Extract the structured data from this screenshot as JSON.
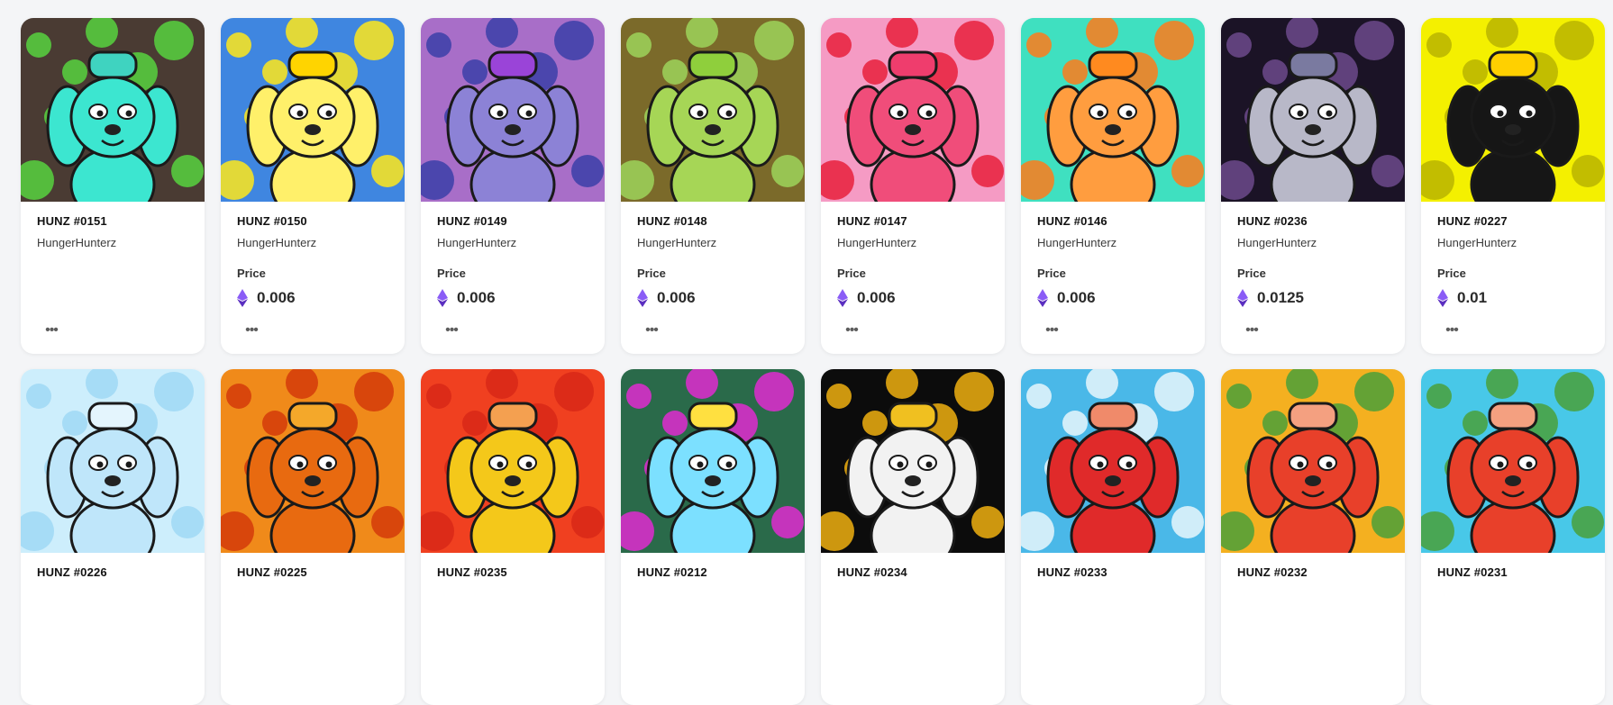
{
  "cards": [
    {
      "title": "HUNZ #0151",
      "collection": "HungerHunterz",
      "price_label": "",
      "price": "",
      "bg": "#4a3b33",
      "accent": "#57d33f",
      "body": "#3ce6d0",
      "hat": "#3fd3c0"
    },
    {
      "title": "HUNZ #0150",
      "collection": "HungerHunterz",
      "price_label": "Price",
      "price": "0.006",
      "bg": "#3f86e0",
      "accent": "#ffe81a",
      "body": "#fff06a",
      "hat": "#ffd400"
    },
    {
      "title": "HUNZ #0149",
      "collection": "HungerHunterz",
      "price_label": "Price",
      "price": "0.006",
      "bg": "#a86ec8",
      "accent": "#3b3fa8",
      "body": "#8c82d6",
      "hat": "#9a44d8"
    },
    {
      "title": "HUNZ #0148",
      "collection": "HungerHunterz",
      "price_label": "Price",
      "price": "0.006",
      "bg": "#7b6a2a",
      "accent": "#9ed35a",
      "body": "#a6d656",
      "hat": "#8fcf3c"
    },
    {
      "title": "HUNZ #0147",
      "collection": "HungerHunterz",
      "price_label": "Price",
      "price": "0.006",
      "bg": "#f59bc4",
      "accent": "#e8203c",
      "body": "#f04d7a",
      "hat": "#ef3d6d"
    },
    {
      "title": "HUNZ #0146",
      "collection": "HungerHunterz",
      "price_label": "Price",
      "price": "0.006",
      "bg": "#3fe0c0",
      "accent": "#ff7a1a",
      "body": "#ff9d3f",
      "hat": "#ff8a1f"
    },
    {
      "title": "HUNZ #0236",
      "collection": "HungerHunterz",
      "price_label": "Price",
      "price": "0.0125",
      "bg": "#1b1326",
      "accent": "#6c4a8c",
      "body": "#b8b8c8",
      "hat": "#7a7aa0"
    },
    {
      "title": "HUNZ #0227",
      "collection": "HungerHunterz",
      "price_label": "Price",
      "price": "0.01",
      "bg": "#f4f000",
      "accent": "#b8b400",
      "body": "#161616",
      "hat": "#ffd000"
    },
    {
      "title": "HUNZ #0226",
      "collection": "",
      "price_label": "",
      "price": "",
      "bg": "#cdeefc",
      "accent": "#9fd8f5",
      "body": "#bfe6fa",
      "hat": "#e4f5fd"
    },
    {
      "title": "HUNZ #0225",
      "collection": "",
      "price_label": "",
      "price": "",
      "bg": "#f08a1a",
      "accent": "#d43a0a",
      "body": "#e86a10",
      "hat": "#f4a82a"
    },
    {
      "title": "HUNZ #0235",
      "collection": "",
      "price_label": "",
      "price": "",
      "bg": "#f04020",
      "accent": "#d82818",
      "body": "#f4c81a",
      "hat": "#f4a050"
    },
    {
      "title": "HUNZ #0212",
      "collection": "",
      "price_label": "",
      "price": "",
      "bg": "#2a6a4a",
      "accent": "#e02ad0",
      "body": "#7ce0ff",
      "hat": "#ffe040"
    },
    {
      "title": "HUNZ #0234",
      "collection": "",
      "price_label": "",
      "price": "",
      "bg": "#0c0c0c",
      "accent": "#f0b010",
      "body": "#f2f2f2",
      "hat": "#f0c020"
    },
    {
      "title": "HUNZ #0233",
      "collection": "",
      "price_label": "",
      "price": "",
      "bg": "#4ab8e8",
      "accent": "#e8f6fc",
      "body": "#e02a2a",
      "hat": "#f08a6a"
    },
    {
      "title": "HUNZ #0232",
      "collection": "",
      "price_label": "",
      "price": "",
      "bg": "#f4b020",
      "accent": "#4aa03a",
      "body": "#e8402a",
      "hat": "#f4a080"
    },
    {
      "title": "HUNZ #0231",
      "collection": "",
      "price_label": "",
      "price": "",
      "bg": "#48c8e8",
      "accent": "#4aa03a",
      "body": "#e8402a",
      "hat": "#f4a080"
    }
  ],
  "icons": {
    "currency": "ethereum-icon",
    "more": "more-options-icon"
  },
  "colors": {
    "eth_top": "#8a5cf6",
    "eth_bottom": "#5b2fc0",
    "text": "#121212"
  }
}
